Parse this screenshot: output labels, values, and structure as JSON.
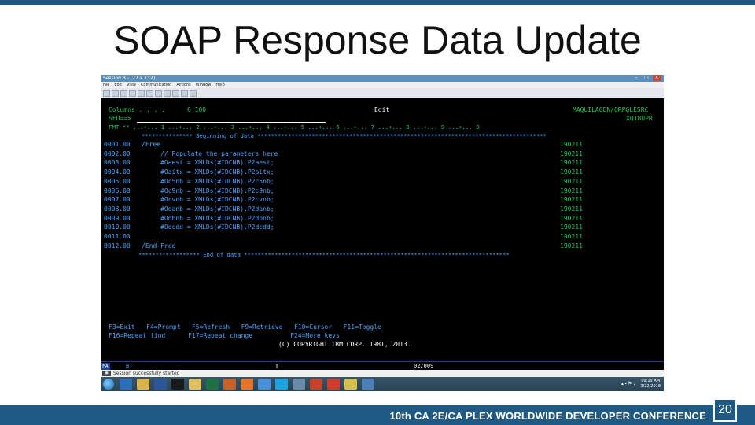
{
  "slide": {
    "title": "SOAP Response Data Update",
    "conference": "10th CA 2E/CA PLEX WORLDWIDE DEVELOPER CONFERENCE",
    "page_number": "20",
    "accent_color": "#1f5a85"
  },
  "emulator": {
    "title": "Session B - [27 x 132]",
    "controls": [
      "minimize-icon",
      "maximize-icon",
      "close-icon"
    ],
    "menu": [
      "File",
      "Edit",
      "View",
      "Communication",
      "Actions",
      "Window",
      "Help"
    ],
    "screen": {
      "columns_label": "Columns . . . :",
      "columns_value": "6 100",
      "mode": "Edit",
      "source_file": "MAQUILAGEN/QRPGLESRC",
      "member": "XQ18UPR",
      "seu_prompt": "SEU==>",
      "format_line": "FMT ** ...+... 1 ...+... 2 ...+... 3 ...+... 4 ...+... 5 ...+... 6 ...+... 7 ...+... 8 ...+... 9 ...+... 0",
      "beginning_marker": "*************** Beginning of data *************************************************************************************",
      "end_marker": "****************** End of data ******************************************************************************",
      "lines": [
        {
          "seq": "0001.00",
          "code": "/Free",
          "date": "190211"
        },
        {
          "seq": "0002.00",
          "code": "     // Populate the parameters here",
          "date": "190211"
        },
        {
          "seq": "0003.00",
          "code": "     #Oaest = XMLDs(#IDCNB).P2aest;",
          "date": "190211"
        },
        {
          "seq": "0004.00",
          "code": "     #Oaitx = XMLDs(#IDCNB).P2aitx;",
          "date": "190211"
        },
        {
          "seq": "0005.00",
          "code": "     #Oc5nb = XMLDs(#IDCNB).P2c5nb;",
          "date": "190211"
        },
        {
          "seq": "0006.00",
          "code": "     #Oc9nb = XMLDs(#IDCNB).P2c9nb;",
          "date": "190211"
        },
        {
          "seq": "0007.00",
          "code": "     #Ocvnb = XMLDs(#IDCNB).P2cvnb;",
          "date": "190211"
        },
        {
          "seq": "0008.00",
          "code": "     #Odanb = XMLDs(#IDCNB).P2danb;",
          "date": "190211"
        },
        {
          "seq": "0009.00",
          "code": "     #Odbnb = XMLDs(#IDCNB).P2dbnb;",
          "date": "190211"
        },
        {
          "seq": "0010.00",
          "code": "     #Odcdd = XMLDs(#IDCNB).P2dcdd;",
          "date": "190211"
        },
        {
          "seq": "0011.00",
          "code": "",
          "date": "190211"
        },
        {
          "seq": "0012.00",
          "code": "/End-Free",
          "date": "190211"
        }
      ],
      "fkeys_row1": "F3=Exit   F4=Prompt   F5=Refresh   F9=Retrieve   F10=Cursor   F11=Toggle",
      "fkeys_row2": "F16=Repeat find      F17=Repeat change          F24=More keys",
      "copyright": "(C) COPYRIGHT IBM CORP. 1981, 2013."
    },
    "status": {
      "indicator": "MA",
      "session": "B",
      "cursor": "02/009"
    },
    "message": "Session successfully started",
    "taskbar": {
      "time": "09:15 AM",
      "date": "3/22/2018"
    }
  }
}
